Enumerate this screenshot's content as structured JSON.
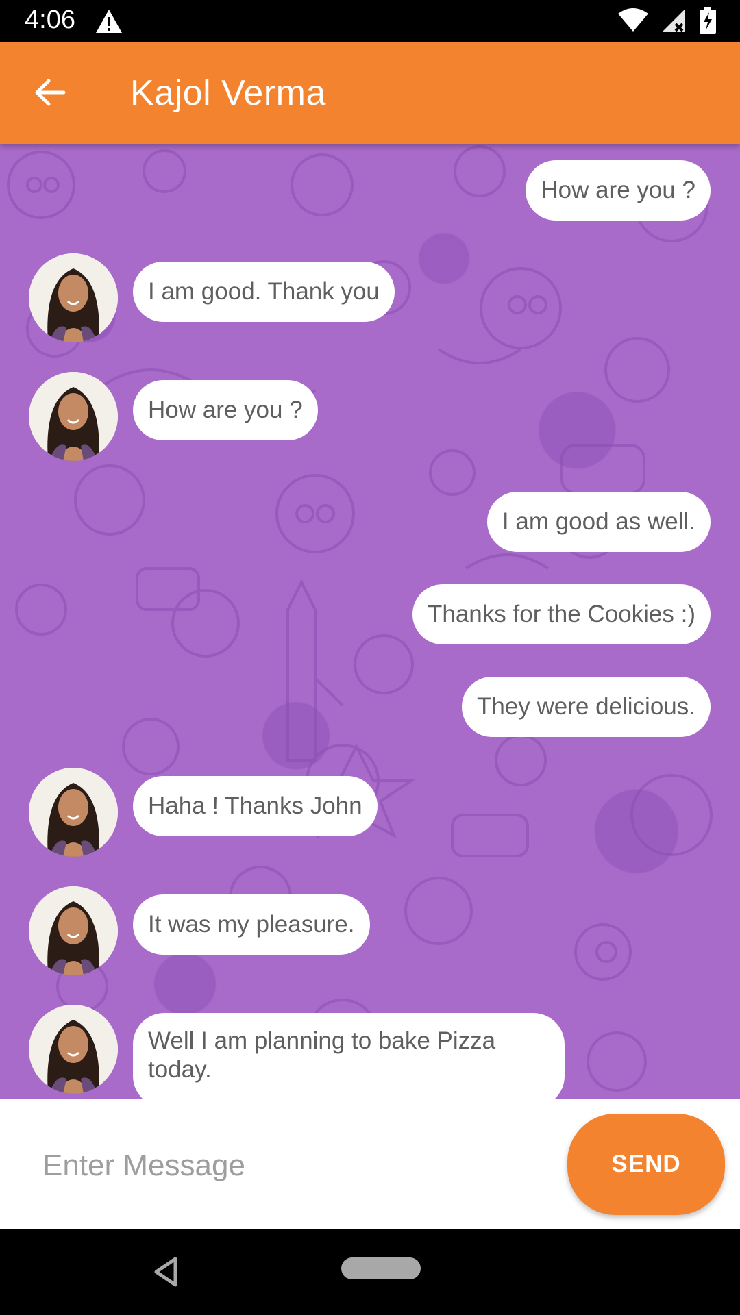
{
  "status_bar": {
    "time": "4:06"
  },
  "app_bar": {
    "title": "Kajol Verma"
  },
  "messages": [
    {
      "side": "sent",
      "text": "How are you ?"
    },
    {
      "side": "received",
      "text": "I am good. Thank you"
    },
    {
      "side": "received",
      "text": "How are you ?"
    },
    {
      "side": "sent",
      "text": "I am good as well."
    },
    {
      "side": "sent",
      "text": "Thanks for the Cookies :)"
    },
    {
      "side": "sent",
      "text": "They were delicious."
    },
    {
      "side": "received",
      "text": "Haha ! Thanks John"
    },
    {
      "side": "received",
      "text": "It was my pleasure."
    },
    {
      "side": "received",
      "text": "Well I am planning to bake Pizza today."
    }
  ],
  "input": {
    "placeholder": "Enter Message",
    "value": ""
  },
  "send_button": {
    "label": "SEND"
  },
  "colors": {
    "accent": "#F3832E",
    "chat_background": "#A96BC9",
    "bubble": "#FFFFFF",
    "text": "#5F5F5F"
  },
  "icons": [
    "back-arrow-icon",
    "warning-icon",
    "wifi-icon",
    "signal-icon",
    "battery-icon",
    "nav-back-icon",
    "nav-home-pill"
  ]
}
